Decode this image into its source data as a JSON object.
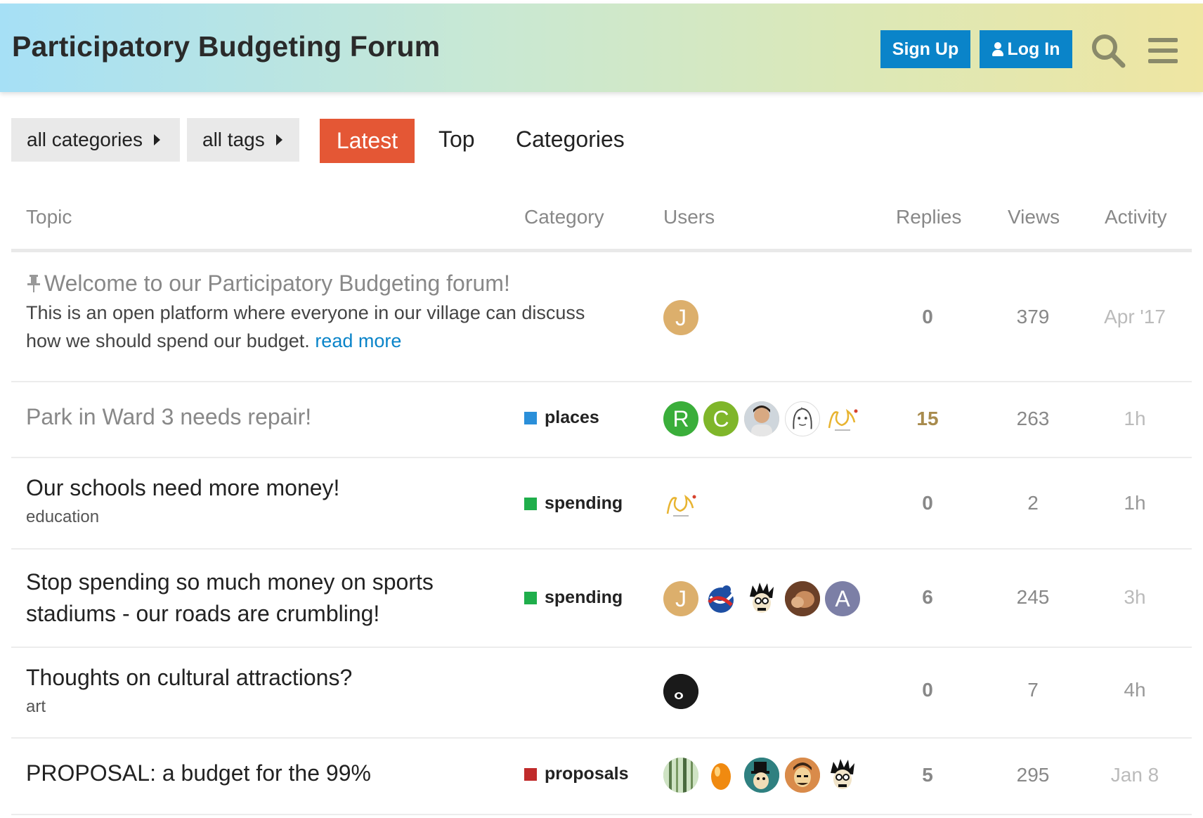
{
  "header": {
    "site_title": "Participatory Budgeting Forum",
    "signup_label": "Sign Up",
    "login_label": "Log In",
    "search_icon": "search-icon",
    "menu_icon": "hamburger-menu-icon",
    "gradient_colors": [
      "#a6e0f6",
      "#c8e8d4",
      "#dbe8b8",
      "#efe6a2"
    ],
    "button_color": "#0a84c9"
  },
  "nav": {
    "categories_filter": "all categories",
    "tags_filter": "all tags",
    "latest": "Latest",
    "top": "Top",
    "categories": "Categories",
    "active_color": "#e45735"
  },
  "columns": {
    "topic": "Topic",
    "category": "Category",
    "users": "Users",
    "replies": "Replies",
    "views": "Views",
    "activity": "Activity"
  },
  "topics": [
    {
      "title": "Welcome to our Participatory Budgeting forum!",
      "pinned": true,
      "excerpt": "This is an open platform where everyone in our village can discuss how we should spend our budget.",
      "read_more": "read more",
      "category": "",
      "users": [
        {
          "letter": "J",
          "color": "#dcaf6c"
        }
      ],
      "replies": "0",
      "views": "379",
      "activity": "Apr '17"
    },
    {
      "title": "Park in Ward 3 needs repair!",
      "category": "places",
      "category_color": "#2a8fd9",
      "users": [
        {
          "letter": "R",
          "color": "#3aae3a"
        },
        {
          "letter": "C",
          "color": "#7fb62a"
        },
        {
          "letter": "",
          "icon": "user-photo-avatar"
        },
        {
          "letter": "",
          "icon": "sketch-portrait-avatar"
        },
        {
          "letter": "",
          "icon": "chamfer-logo-avatar"
        }
      ],
      "replies": "15",
      "views": "263",
      "activity": "1h"
    },
    {
      "title": "Our schools need more money!",
      "tag": "education",
      "category": "spending",
      "category_color": "#1fae4b",
      "users": [
        {
          "letter": "",
          "icon": "chamfer-logo-avatar"
        }
      ],
      "replies": "0",
      "views": "2",
      "activity": "1h"
    },
    {
      "title": "Stop spending so much money on sports stadiums - our roads are crumbling!",
      "category": "spending",
      "category_color": "#1fae4b",
      "users": [
        {
          "letter": "J",
          "color": "#dcaf6c"
        },
        {
          "letter": "",
          "icon": "globe-logo-avatar"
        },
        {
          "letter": "",
          "icon": "cartoon-face-avatar"
        },
        {
          "letter": "",
          "icon": "user-photo-avatar"
        },
        {
          "letter": "A",
          "color": "#7c7fa6"
        }
      ],
      "replies": "6",
      "views": "245",
      "activity": "3h"
    },
    {
      "title": "Thoughts on cultural attractions?",
      "tag": "art",
      "category": "",
      "users": [
        {
          "letter": "",
          "icon": "dark-eye-avatar"
        }
      ],
      "replies": "0",
      "views": "7",
      "activity": "4h"
    },
    {
      "title": "PROPOSAL: a budget for the 99%",
      "category": "proposals",
      "category_color": "#c02b2b",
      "users": [
        {
          "letter": "",
          "icon": "forest-photo-avatar"
        },
        {
          "letter": "",
          "icon": "golden-egg-avatar"
        },
        {
          "letter": "",
          "icon": "top-hat-avatar"
        },
        {
          "letter": "",
          "icon": "cartoon-man-avatar"
        },
        {
          "letter": "",
          "icon": "cartoon-face-avatar"
        }
      ],
      "replies": "5",
      "views": "295",
      "activity": "Jan 8"
    }
  ]
}
